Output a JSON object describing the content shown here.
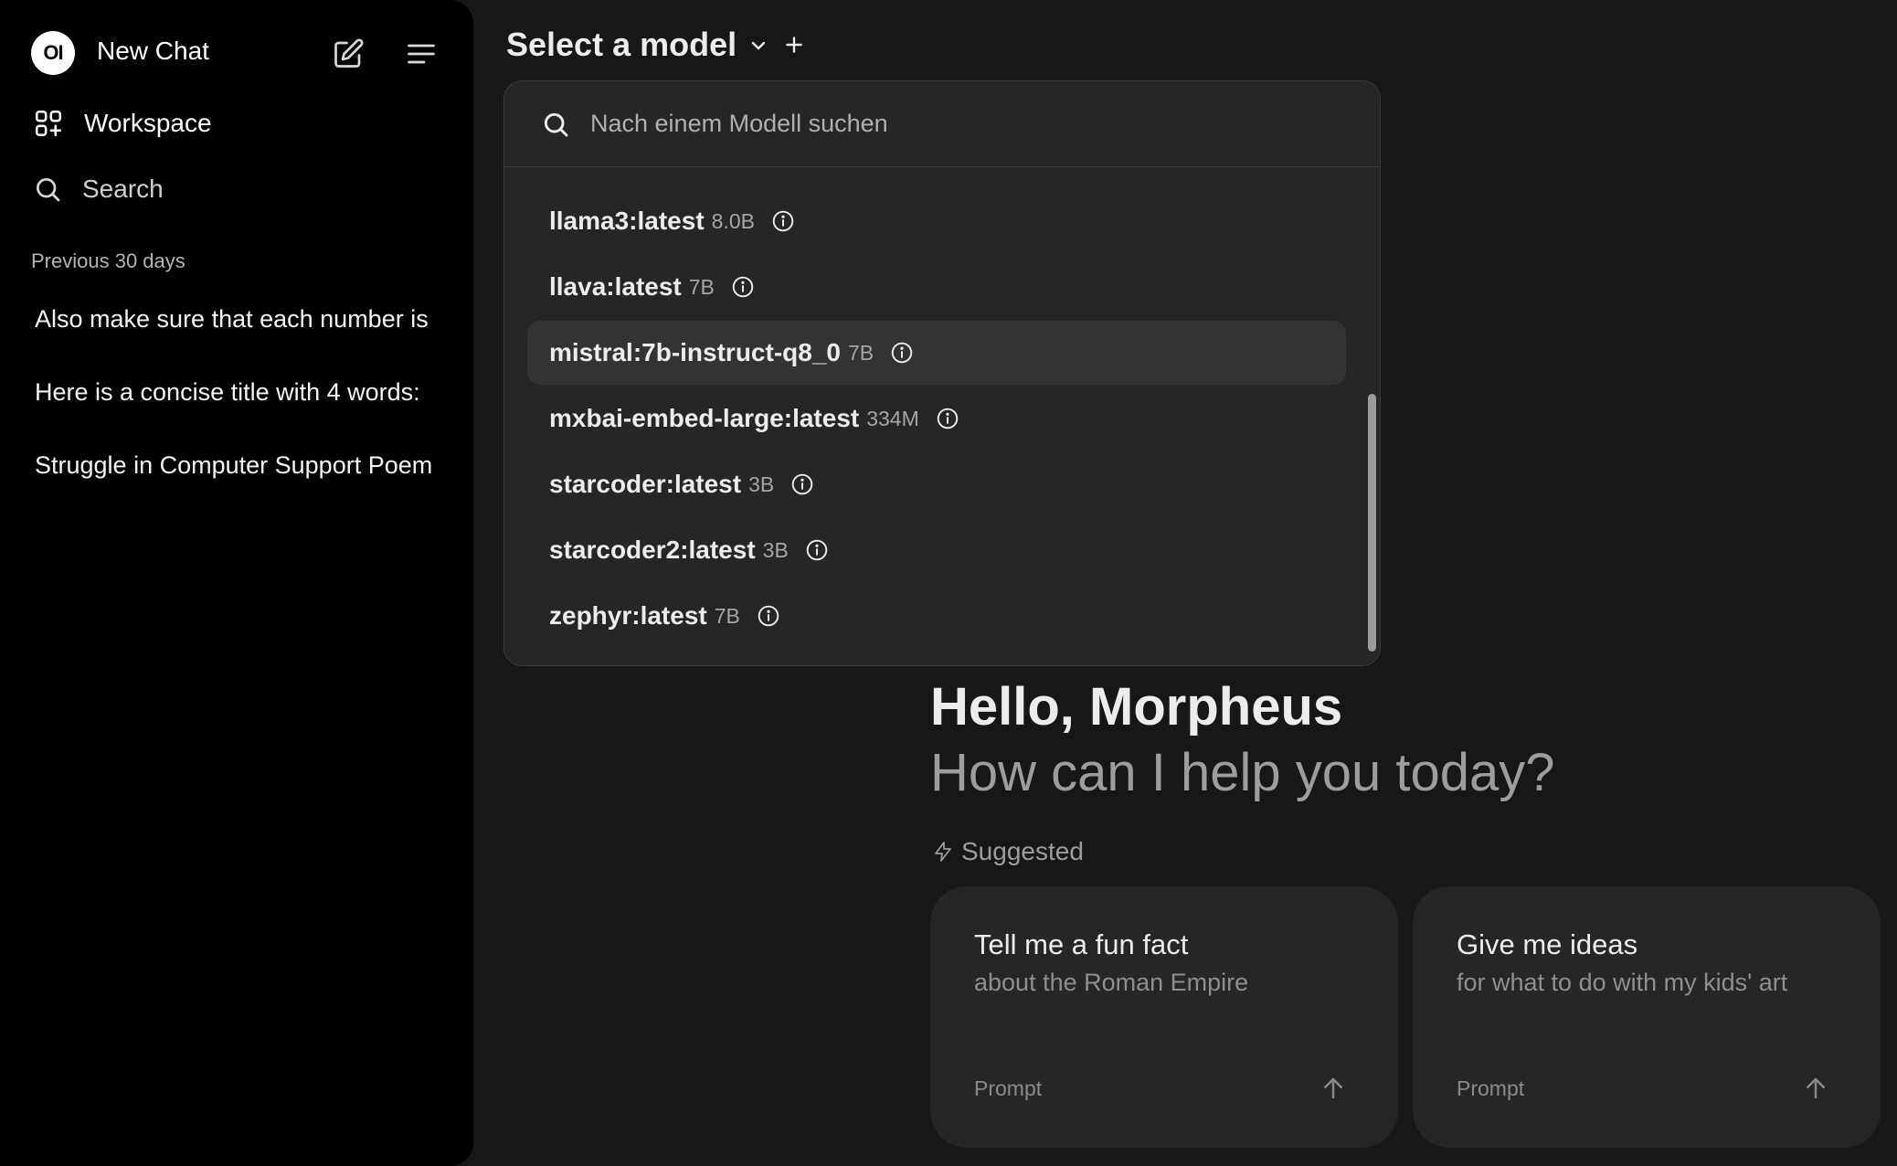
{
  "sidebar": {
    "logo_text": "OI",
    "new_chat": "New Chat",
    "workspace": "Workspace",
    "search": "Search",
    "section_title": "Previous 30 days",
    "history": [
      "Also make sure that each number is",
      "Here is a concise title with 4 words:",
      "Struggle in Computer Support Poem"
    ]
  },
  "header": {
    "model_selector": "Select a model"
  },
  "dropdown": {
    "search_placeholder": "Nach einem Modell suchen",
    "models": [
      {
        "name": "llama3:latest",
        "size": "8.0B"
      },
      {
        "name": "llava:latest",
        "size": "7B"
      },
      {
        "name": "mistral:7b-instruct-q8_0",
        "size": "7B"
      },
      {
        "name": "mxbai-embed-large:latest",
        "size": "334M"
      },
      {
        "name": "starcoder:latest",
        "size": "3B"
      },
      {
        "name": "starcoder2:latest",
        "size": "3B"
      },
      {
        "name": "zephyr:latest",
        "size": "7B"
      }
    ],
    "active_index": 2
  },
  "main": {
    "greeting": "Hello, Morpheus",
    "subtitle": "How can I help you today?",
    "suggested_label": "Suggested",
    "cards": [
      {
        "title": "Tell me a fun fact",
        "subtitle": "about the Roman Empire",
        "prompt_label": "Prompt"
      },
      {
        "title": "Give me ideas",
        "subtitle": "for what to do with my kids' art",
        "prompt_label": "Prompt"
      }
    ]
  },
  "colors": {
    "background": "#171717",
    "sidebar": "#000000",
    "dropdown": "#262626",
    "active_item": "#333333"
  }
}
